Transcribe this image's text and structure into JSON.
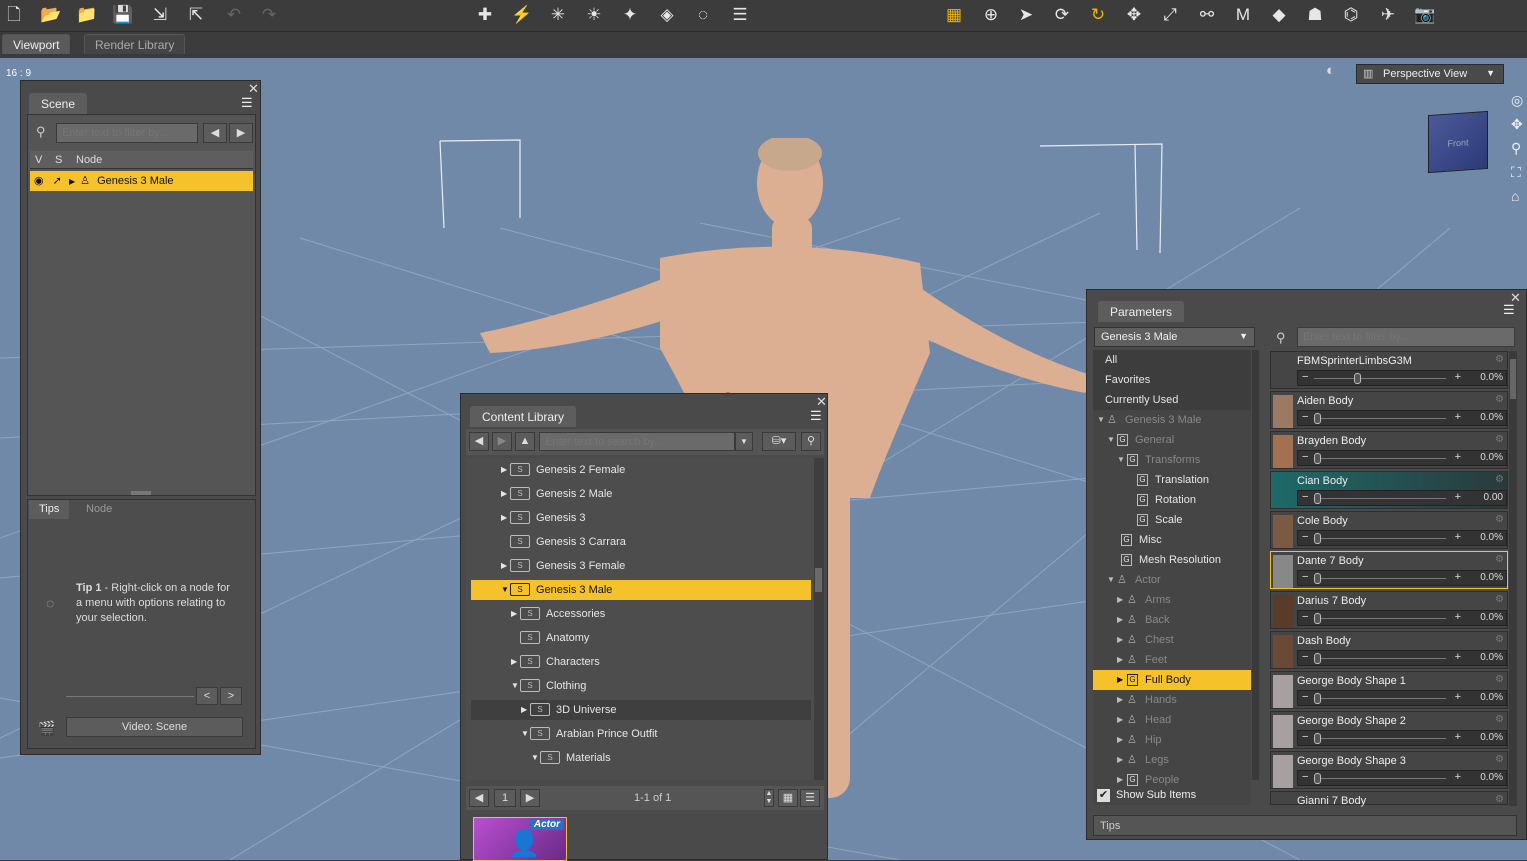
{
  "colors": {
    "accent": "#f6c22b",
    "viewport_bg": "#7189a9",
    "panel_bg": "#4a4a4a"
  },
  "toolbar": {
    "icons": [
      "new-file-icon",
      "open-icon",
      "open-folder-icon",
      "save-icon",
      "import-icon",
      "export-icon",
      "undo-icon",
      "redo-icon",
      "create-figure-icon",
      "spotlight-icon",
      "distant-light-icon",
      "point-light-icon",
      "linear-point-light-icon",
      "render-icon",
      "render-settings-icon",
      "menu-icon",
      "node-selection-icon",
      "universal-tool-icon",
      "pointer-icon",
      "orbit-icon",
      "rotate-icon",
      "translate-icon",
      "scale-icon",
      "joint-editor-icon",
      "geometry-editor-icon",
      "surface-selection-icon",
      "posing-icon",
      "figure-tool-icon",
      "camera-icon",
      "screenshot-icon"
    ]
  },
  "viewport_tabs": [
    "Viewport",
    "Render Library"
  ],
  "aspect_label": "16 : 9",
  "view_dropdown": "Perspective View",
  "cube_label": "Front",
  "scene": {
    "tab": "Scene",
    "filter_placeholder": "Enter text to filter by...",
    "columns": [
      "V",
      "S",
      "Node"
    ],
    "rows": [
      {
        "label": "Genesis 3 Male",
        "selected": true
      }
    ],
    "sub_tabs": [
      "Tips",
      "Node"
    ],
    "tip_title": "Tip 1",
    "tip_text": " - Right-click on a node for a menu with options relating to your selection.",
    "prev": "<",
    "next": ">",
    "video_button": "Video: Scene"
  },
  "content_library": {
    "tab": "Content Library",
    "search_placeholder": "Enter text to search by...",
    "items": [
      {
        "label": "Genesis 2 Female",
        "indent": 0,
        "arrow": "▶"
      },
      {
        "label": "Genesis 2 Male",
        "indent": 0,
        "arrow": "▶"
      },
      {
        "label": "Genesis 3",
        "indent": 0,
        "arrow": "▶"
      },
      {
        "label": "Genesis 3 Carrara",
        "indent": 0,
        "arrow": ""
      },
      {
        "label": "Genesis 3 Female",
        "indent": 0,
        "arrow": "▶"
      },
      {
        "label": "Genesis 3 Male",
        "indent": 0,
        "arrow": "▼",
        "selected": true
      },
      {
        "label": "Accessories",
        "indent": 1,
        "arrow": "▶"
      },
      {
        "label": "Anatomy",
        "indent": 1,
        "arrow": ""
      },
      {
        "label": "Characters",
        "indent": 1,
        "arrow": "▶"
      },
      {
        "label": "Clothing",
        "indent": 1,
        "arrow": "▼"
      },
      {
        "label": "3D Universe",
        "indent": 2,
        "arrow": "▶",
        "hover": true
      },
      {
        "label": "Arabian Prince Outfit",
        "indent": 2,
        "arrow": "▼"
      },
      {
        "label": "Materials",
        "indent": 3,
        "arrow": "▼"
      }
    ],
    "page": "1",
    "page_info": "1-1 of 1",
    "thumb_badge": "Actor"
  },
  "parameters": {
    "tab": "Parameters",
    "figure": "Genesis 3 Male",
    "filter_placeholder": "Enter text to filter by...",
    "tree": [
      {
        "label": "All",
        "indent": 0,
        "type": "plain"
      },
      {
        "label": "Favorites",
        "indent": 0,
        "type": "plain"
      },
      {
        "label": "Currently Used",
        "indent": 0,
        "type": "plain"
      },
      {
        "label": "Genesis 3 Male",
        "indent": 0,
        "type": "figure",
        "arrow": "▼",
        "dim": true
      },
      {
        "label": "General",
        "indent": 1,
        "type": "g",
        "arrow": "▼",
        "dim": true
      },
      {
        "label": "Transforms",
        "indent": 2,
        "type": "g",
        "arrow": "▼",
        "dim": true
      },
      {
        "label": "Translation",
        "indent": 3,
        "type": "g"
      },
      {
        "label": "Rotation",
        "indent": 3,
        "type": "g"
      },
      {
        "label": "Scale",
        "indent": 3,
        "type": "g"
      },
      {
        "label": "Misc",
        "indent": 2,
        "type": "g"
      },
      {
        "label": "Mesh Resolution",
        "indent": 2,
        "type": "g"
      },
      {
        "label": "Actor",
        "indent": 1,
        "type": "figure",
        "arrow": "▼",
        "dim": true
      },
      {
        "label": "Arms",
        "indent": 2,
        "type": "figure",
        "arrow": "▶",
        "dim": true
      },
      {
        "label": "Back",
        "indent": 2,
        "type": "figure",
        "arrow": "▶",
        "dim": true
      },
      {
        "label": "Chest",
        "indent": 2,
        "type": "figure",
        "arrow": "▶",
        "dim": true
      },
      {
        "label": "Feet",
        "indent": 2,
        "type": "figure",
        "arrow": "▶",
        "dim": true
      },
      {
        "label": "Full Body",
        "indent": 2,
        "type": "g",
        "arrow": "▶",
        "selected": true
      },
      {
        "label": "Hands",
        "indent": 2,
        "type": "figure",
        "arrow": "▶",
        "dim": true
      },
      {
        "label": "Head",
        "indent": 2,
        "type": "figure",
        "arrow": "▶",
        "dim": true
      },
      {
        "label": "Hip",
        "indent": 2,
        "type": "figure",
        "arrow": "▶",
        "dim": true
      },
      {
        "label": "Legs",
        "indent": 2,
        "type": "figure",
        "arrow": "▶",
        "dim": true
      },
      {
        "label": "People",
        "indent": 2,
        "type": "g",
        "arrow": "▶",
        "dim": true
      }
    ],
    "show_sub_items": "Show Sub Items",
    "sliders": [
      {
        "label": "FBMSprinterLimbsG3M",
        "value": "0.0%",
        "level": 0.3,
        "thumb": false
      },
      {
        "label": "Aiden Body",
        "value": "0.0%",
        "level": 0,
        "thumb": true,
        "tone": "#9b7a64"
      },
      {
        "label": "Brayden Body",
        "value": "0.0%",
        "level": 0,
        "thumb": true,
        "tone": "#a47052"
      },
      {
        "label": "Cian Body",
        "value": "0.00",
        "level": 0,
        "thumb": false,
        "teal": true
      },
      {
        "label": "Cole Body",
        "value": "0.0%",
        "level": 0,
        "thumb": true,
        "tone": "#7a5a42"
      },
      {
        "label": "Dante 7 Body",
        "value": "0.0%",
        "level": 0,
        "thumb": true,
        "tone": "#888",
        "highlight": true
      },
      {
        "label": "Darius 7 Body",
        "value": "0.0%",
        "level": 0,
        "thumb": true,
        "tone": "#5a3a28"
      },
      {
        "label": "Dash Body",
        "value": "0.0%",
        "level": 0,
        "thumb": true,
        "tone": "#6a4a36"
      },
      {
        "label": "George Body Shape 1",
        "value": "0.0%",
        "level": 0,
        "thumb": true,
        "tone": "#a8a0a0"
      },
      {
        "label": "George Body Shape 2",
        "value": "0.0%",
        "level": 0,
        "thumb": true,
        "tone": "#a8a0a0"
      },
      {
        "label": "George Body Shape 3",
        "value": "0.0%",
        "level": 0,
        "thumb": true,
        "tone": "#a8a0a0"
      },
      {
        "label": "Gianni 7 Body",
        "value": "",
        "level": 0,
        "thumb": false
      }
    ],
    "tips_tab": "Tips"
  }
}
